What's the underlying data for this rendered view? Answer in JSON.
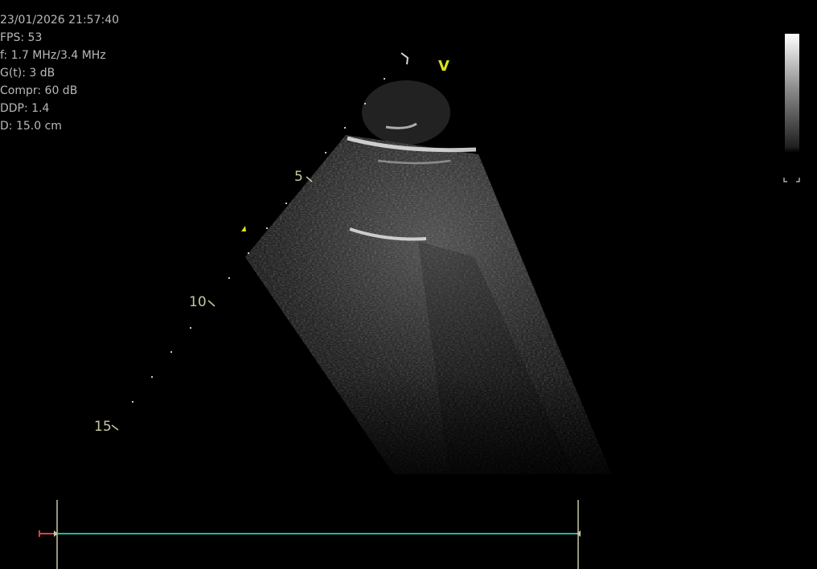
{
  "info": {
    "datetime": "23/01/2026 21:57:40",
    "fps": "FPS: 53",
    "frequency": "f: 1.7 MHz/3.4 MHz",
    "gain": "G(t):  3 dB",
    "compression": "Compr: 60 dB",
    "ddp": "DDP: 1.4",
    "depth": "D: 15.0 cm"
  },
  "depth_scale": {
    "label_5": "5",
    "label_10": "10",
    "label_15": "15"
  },
  "orientation_marker": "V",
  "colors": {
    "text": "#b9b9b9",
    "depth_label": "#c8c7a0",
    "orientation": "#d9e21a",
    "ecg_line": "#1fb5a8",
    "calipers": "#c8c7a0",
    "ecg_start": "#e0404a"
  }
}
